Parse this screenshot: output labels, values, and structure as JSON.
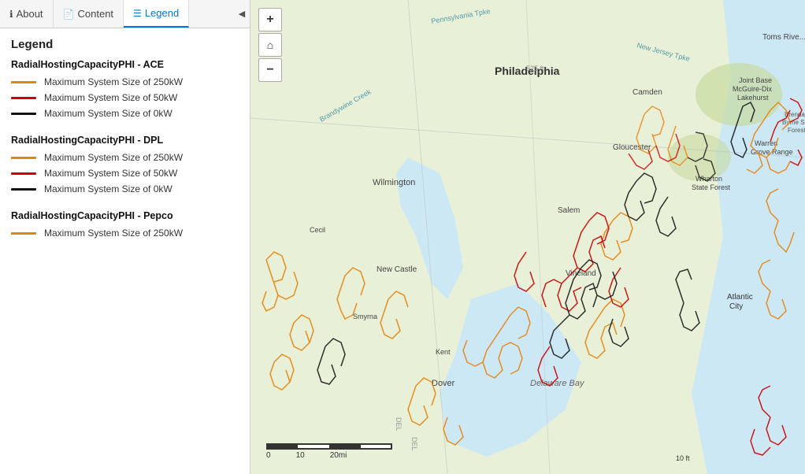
{
  "tabs": [
    {
      "id": "about",
      "label": "About",
      "icon": "ℹ",
      "active": false
    },
    {
      "id": "content",
      "label": "Content",
      "icon": "📄",
      "active": false
    },
    {
      "id": "legend",
      "label": "Legend",
      "icon": "≡",
      "active": true
    }
  ],
  "legend": {
    "title": "Legend",
    "sections": [
      {
        "id": "ace",
        "title": "RadialHostingCapacityPHI - ACE",
        "items": [
          {
            "color": "#E8820C",
            "label": "Maximum System Size of 250kW"
          },
          {
            "color": "#CC0000",
            "label": "Maximum System Size of 50kW"
          },
          {
            "color": "#111111",
            "label": "Maximum System Size of 0kW"
          }
        ]
      },
      {
        "id": "dpl",
        "title": "RadialHostingCapacityPHI - DPL",
        "items": [
          {
            "color": "#E8820C",
            "label": "Maximum System Size of 250kW"
          },
          {
            "color": "#CC0000",
            "label": "Maximum System Size of 50kW"
          },
          {
            "color": "#111111",
            "label": "Maximum System Size of 0kW"
          }
        ]
      },
      {
        "id": "pepco",
        "title": "RadialHostingCapacityPHI - Pepco",
        "items": [
          {
            "color": "#E8820C",
            "label": "Maximum System Size of 250kW"
          }
        ]
      }
    ]
  },
  "map_controls": {
    "zoom_in": "+",
    "home": "⌂",
    "zoom_out": "−"
  },
  "scale": {
    "labels": [
      "0",
      "10",
      "20mi"
    ]
  }
}
